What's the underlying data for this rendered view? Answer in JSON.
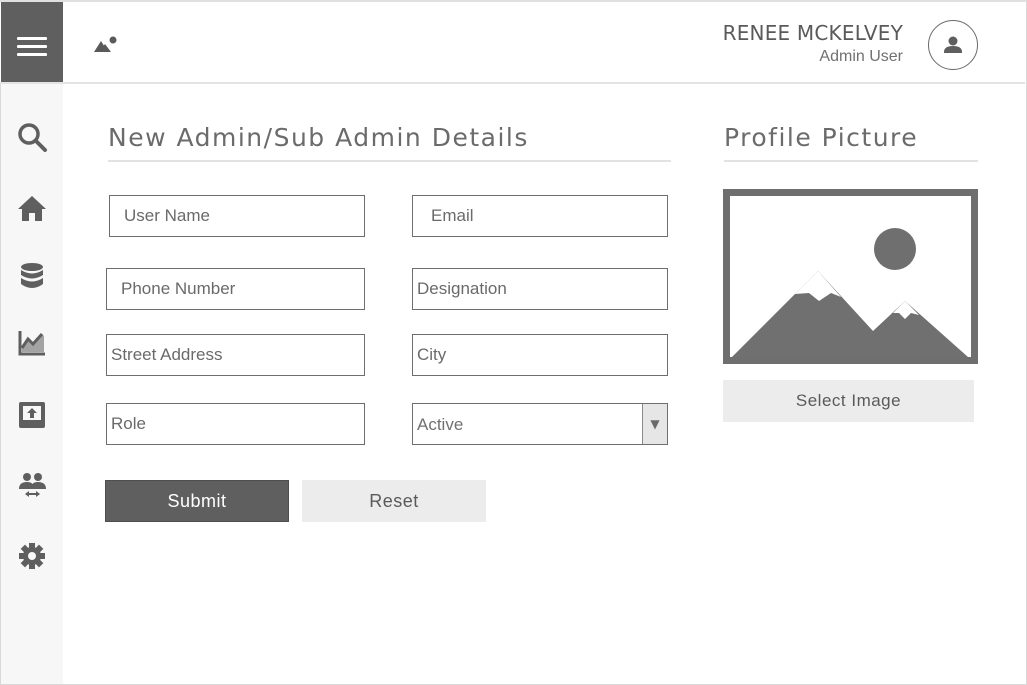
{
  "header": {
    "user_name": "RENEE MCKELVEY",
    "user_role": "Admin User",
    "menu_icon": "hamburger-icon",
    "logo_icon": "mountain-logo-icon",
    "avatar_icon": "user-avatar-icon"
  },
  "sidebar": {
    "items": [
      {
        "name": "search",
        "icon": "search-icon"
      },
      {
        "name": "home",
        "icon": "home-icon"
      },
      {
        "name": "database",
        "icon": "database-icon"
      },
      {
        "name": "analytics",
        "icon": "line-chart-icon"
      },
      {
        "name": "upload",
        "icon": "upload-box-icon"
      },
      {
        "name": "users",
        "icon": "user-transfer-icon"
      },
      {
        "name": "settings",
        "icon": "gear-icon"
      }
    ]
  },
  "form": {
    "title": "New Admin/Sub Admin Details",
    "fields": {
      "user_name": "User Name",
      "email": "Email",
      "phone": "Phone Number",
      "designation": "Designation",
      "street": "Street Address",
      "city": "City",
      "role": "Role"
    },
    "status_select": {
      "selected": "Active"
    },
    "submit_label": "Submit",
    "reset_label": "Reset"
  },
  "profile": {
    "title": "Profile Picture",
    "image_icon": "image-placeholder-icon",
    "select_label": "Select Image"
  },
  "colors": {
    "dark": "#5f5f5f",
    "sidebar_bg": "#f7f7f7",
    "button_light": "#ececec"
  }
}
